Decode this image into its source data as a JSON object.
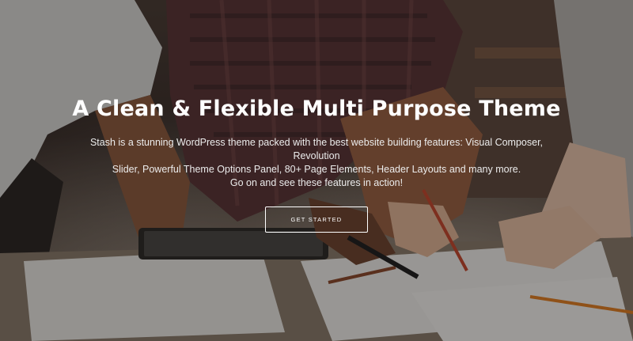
{
  "hero": {
    "headline": "A Clean & Flexible Multi Purpose Theme",
    "description_lines": [
      "Stash is a stunning WordPress theme packed with the best website building features: Visual Composer, Revolution",
      "Slider, Powerful Theme Options Panel, 80+ Page Elements, Header Layouts and many more.",
      "Go on and see these features in action!"
    ],
    "cta_label": "GET STARTED"
  },
  "background": {
    "subject": "team-working-over-documents-photo",
    "overlay_color": "#0a0808"
  }
}
